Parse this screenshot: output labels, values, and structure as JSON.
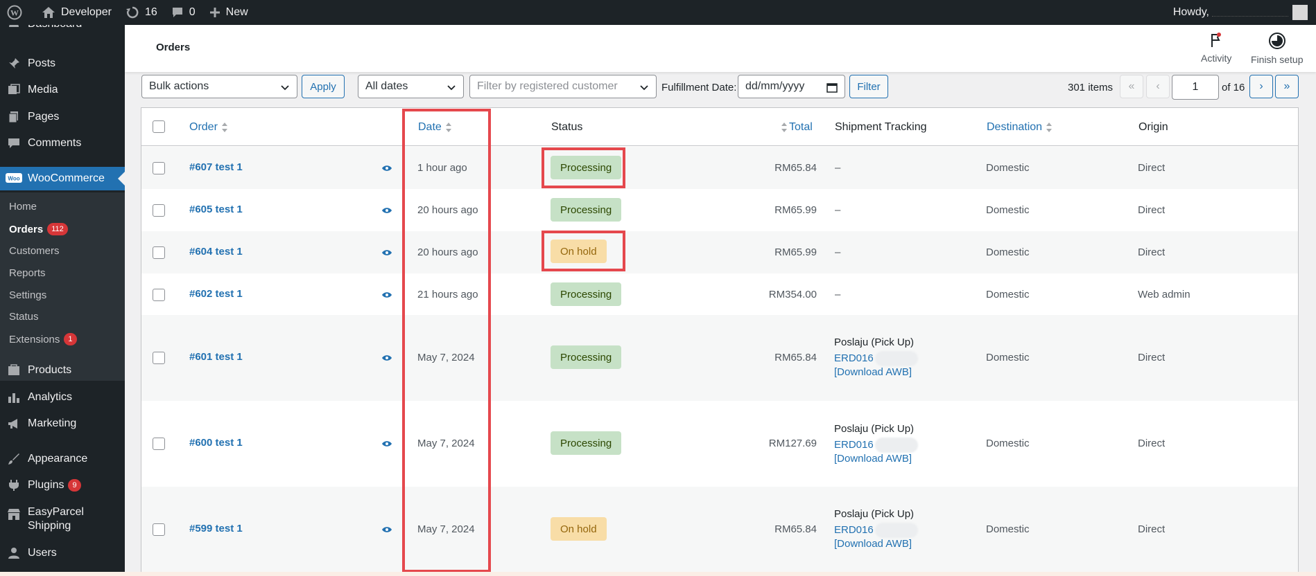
{
  "admin_bar": {
    "site_name": "Developer",
    "updates_count": "16",
    "comments_count": "0",
    "new_label": "New",
    "howdy": "Howdy,"
  },
  "sidebar": {
    "items": [
      {
        "label": "Dashboard",
        "icon": "dashboard-icon"
      },
      {
        "label": "Posts",
        "icon": "pin-icon"
      },
      {
        "label": "Media",
        "icon": "media-icon"
      },
      {
        "label": "Pages",
        "icon": "pages-icon"
      },
      {
        "label": "Comments",
        "icon": "comment-icon"
      },
      {
        "label": "WooCommerce",
        "icon": "woo-icon"
      },
      {
        "label": "Products",
        "icon": "products-icon"
      },
      {
        "label": "Analytics",
        "icon": "analytics-icon"
      },
      {
        "label": "Marketing",
        "icon": "megaphone-icon"
      },
      {
        "label": "Appearance",
        "icon": "brush-icon"
      },
      {
        "label": "Plugins",
        "icon": "plugin-icon",
        "badge": "9"
      },
      {
        "label": "EasyParcel",
        "label2": "Shipping",
        "icon": "store-icon"
      },
      {
        "label": "Users",
        "icon": "users-icon"
      }
    ],
    "woo_submenu": [
      {
        "label": "Home"
      },
      {
        "label": "Orders",
        "badge": "112"
      },
      {
        "label": "Customers"
      },
      {
        "label": "Reports"
      },
      {
        "label": "Settings"
      },
      {
        "label": "Status"
      },
      {
        "label": "Extensions",
        "badge": "1"
      }
    ]
  },
  "header": {
    "title": "Orders",
    "activity_label": "Activity",
    "finish_setup_label": "Finish setup"
  },
  "tablenav": {
    "bulk_actions": "Bulk actions",
    "apply": "Apply",
    "all_dates": "All dates",
    "customer_placeholder": "Filter by registered customer",
    "fulfillment_label": "Fulfillment Date:",
    "date_placeholder": "dd/mm/yyyy",
    "filter": "Filter",
    "items_count": "301 items",
    "first": "«",
    "prev": "‹",
    "current_page": "1",
    "of_pages": "of 16",
    "next": "›",
    "last": "»"
  },
  "table": {
    "columns": {
      "order": "Order",
      "date": "Date",
      "status": "Status",
      "total": "Total",
      "shipment": "Shipment Tracking",
      "destination": "Destination",
      "origin": "Origin"
    },
    "rows": [
      {
        "order": "#607 test 1",
        "date": "1 hour ago",
        "status": "Processing",
        "total": "RM65.84",
        "shipment": "–",
        "destination": "Domestic",
        "origin": "Direct"
      },
      {
        "order": "#605 test 1",
        "date": "20 hours ago",
        "status": "Processing",
        "total": "RM65.99",
        "shipment": "–",
        "destination": "Domestic",
        "origin": "Direct"
      },
      {
        "order": "#604 test 1",
        "date": "20 hours ago",
        "status": "On hold",
        "total": "RM65.99",
        "shipment": "–",
        "destination": "Domestic",
        "origin": "Direct"
      },
      {
        "order": "#602 test 1",
        "date": "21 hours ago",
        "status": "Processing",
        "total": "RM354.00",
        "shipment": "–",
        "destination": "Domestic",
        "origin": "Web admin"
      },
      {
        "order": "#601 test 1",
        "date": "May 7, 2024",
        "status": "Processing",
        "total": "RM65.84",
        "ship_title": "Poslaju (Pick Up)",
        "ship_code": "ERD016",
        "ship_awb": "[Download AWB]",
        "destination": "Domestic",
        "origin": "Direct"
      },
      {
        "order": "#600 test 1",
        "date": "May 7, 2024",
        "status": "Processing",
        "total": "RM127.69",
        "ship_title": "Poslaju (Pick Up)",
        "ship_code": "ERD016",
        "ship_awb": "[Download AWB]",
        "destination": "Domestic",
        "origin": "Direct"
      },
      {
        "order": "#599 test 1",
        "date": "May 7, 2024",
        "status": "On hold",
        "total": "RM65.84",
        "ship_title": "Poslaju (Pick Up)",
        "ship_code": "ERD016",
        "ship_awb": "[Download AWB]",
        "destination": "Domestic",
        "origin": "Direct"
      }
    ]
  },
  "colors": {
    "accent": "#2271b1",
    "admin_bg": "#1d2327",
    "highlight": "#e5484d",
    "processing_bg": "#c6e1c6",
    "onhold_bg": "#f8dda7"
  }
}
